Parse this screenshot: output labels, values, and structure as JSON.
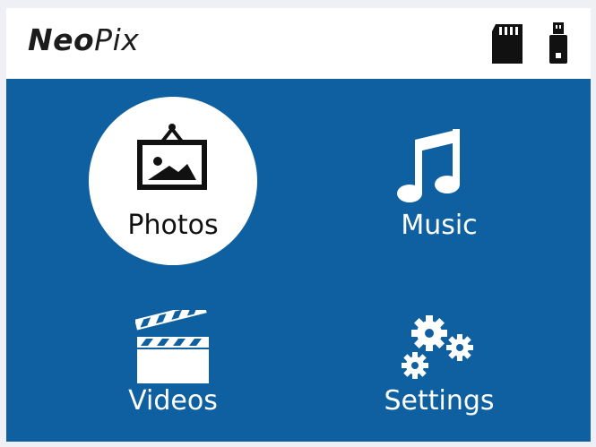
{
  "header": {
    "logo_bold": "Neo",
    "logo_light": "Pix",
    "status_icons": [
      "sd-card-icon",
      "usb-drive-icon"
    ]
  },
  "menu": {
    "selected": "photos",
    "items": [
      {
        "id": "photos",
        "label": "Photos",
        "icon": "photo-frame-icon"
      },
      {
        "id": "music",
        "label": "Music",
        "icon": "music-note-icon"
      },
      {
        "id": "videos",
        "label": "Videos",
        "icon": "clapperboard-icon"
      },
      {
        "id": "settings",
        "label": "Settings",
        "icon": "gears-icon"
      }
    ]
  },
  "colors": {
    "background": "#0f60a0",
    "header": "#ffffff",
    "selected_circle": "#ffffff",
    "text_on_blue": "#ffffff",
    "text_on_white": "#111111"
  }
}
